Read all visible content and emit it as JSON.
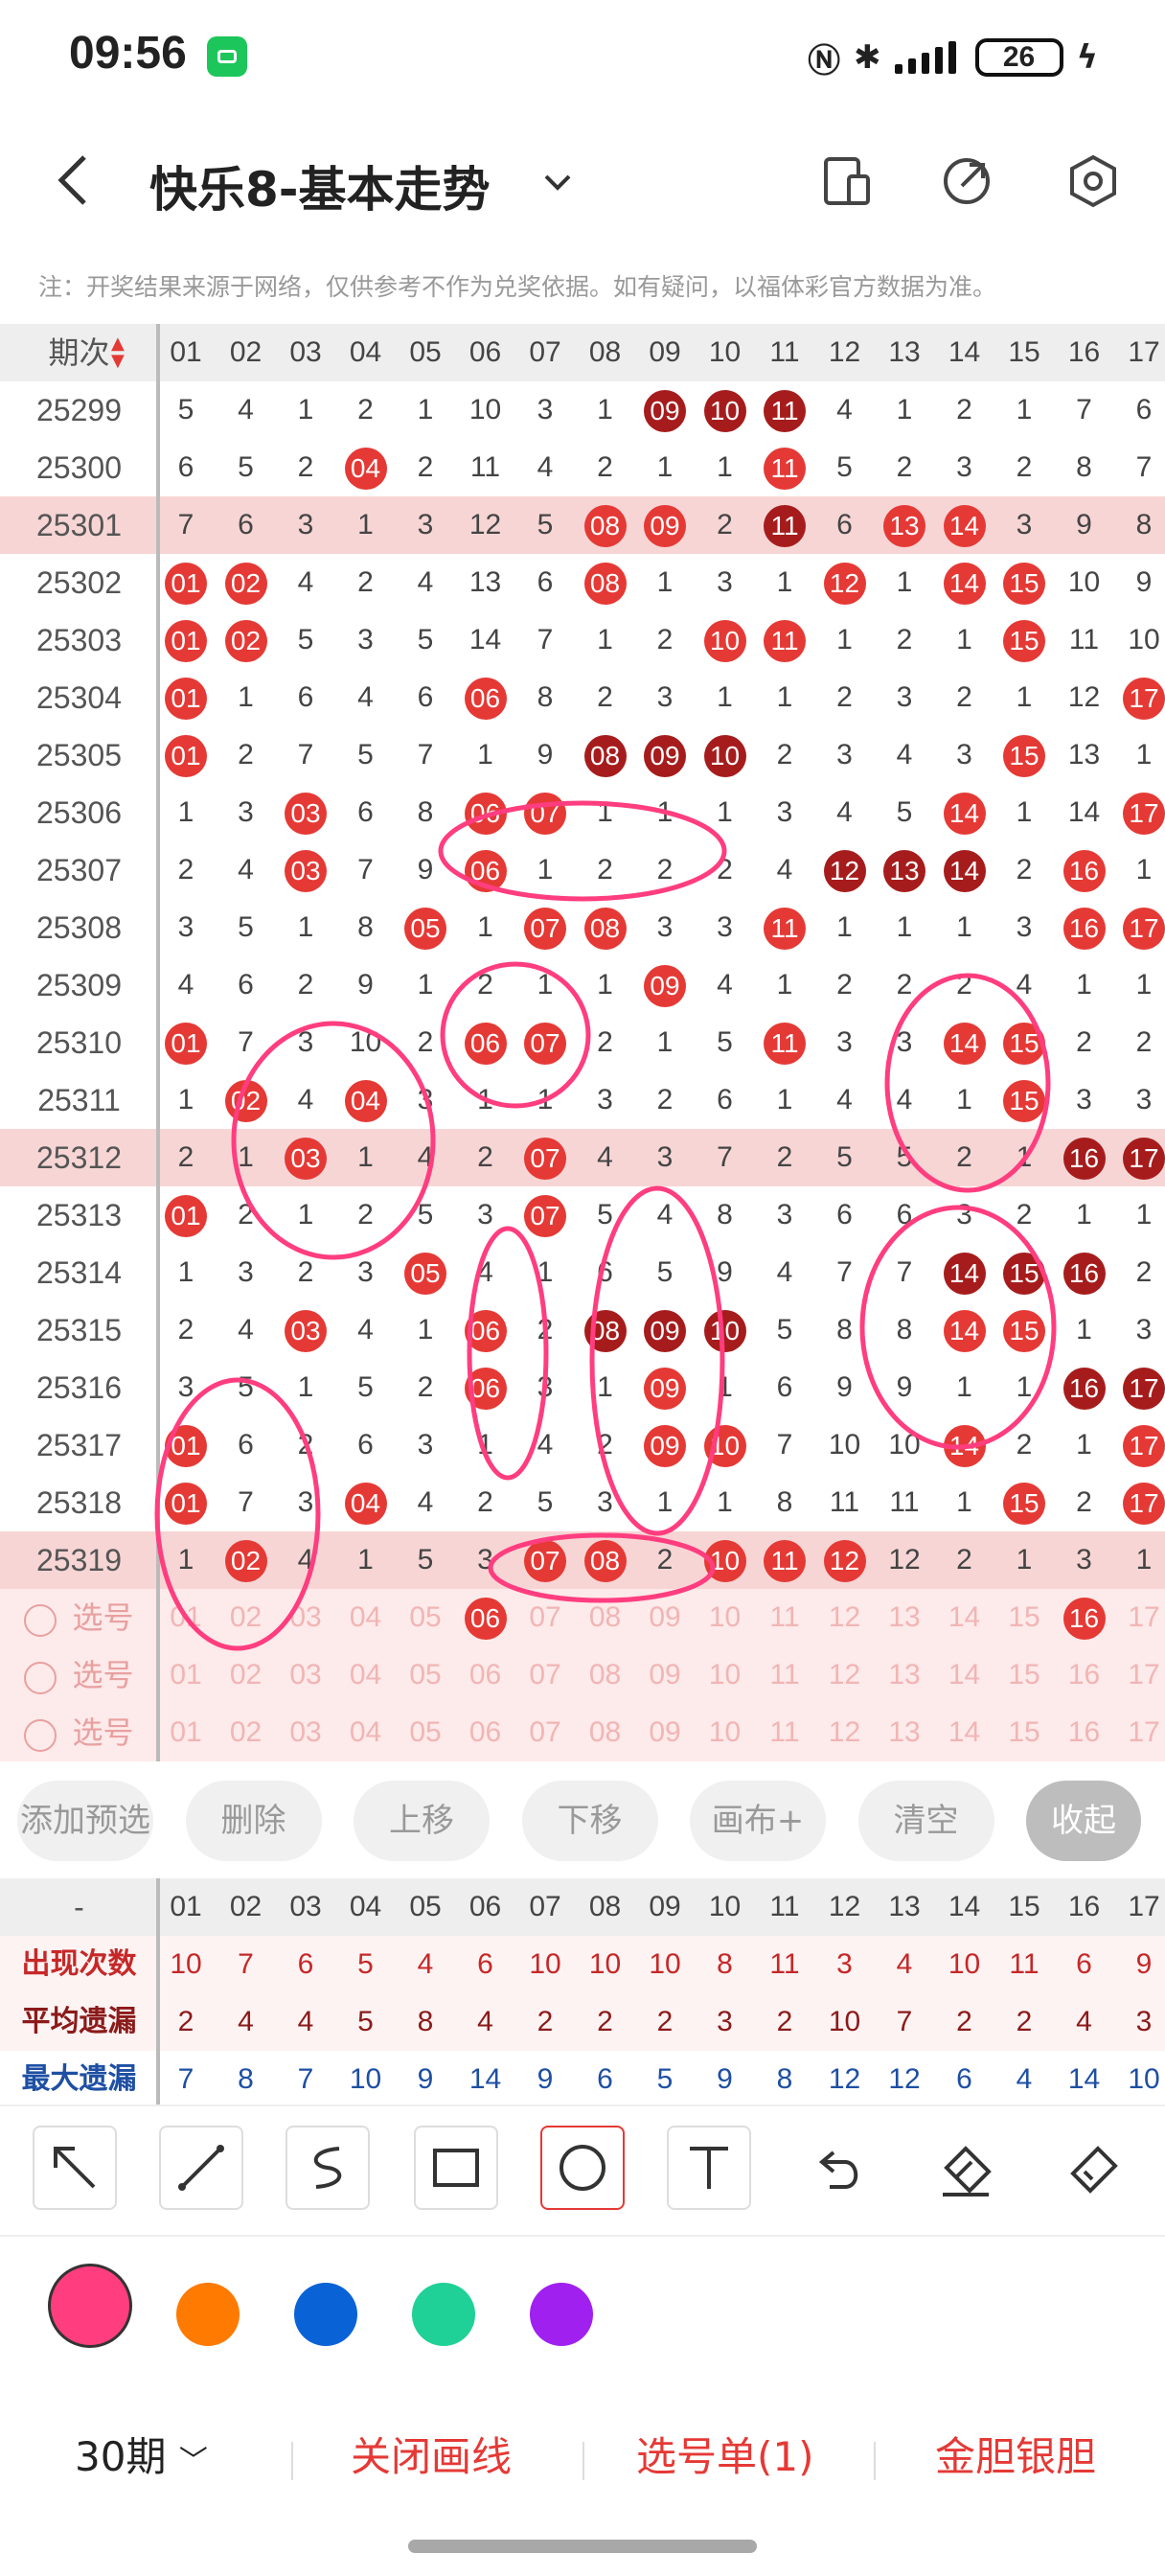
{
  "status": {
    "time": "09:56",
    "battery": "26"
  },
  "header": {
    "title": "快乐8-基本走势"
  },
  "notice": "注：开奖结果来源于网络，仅供参考不作为兑奖依据。如有疑问，以福体彩官方数据为准。",
  "table": {
    "period_header": "期次",
    "columns": [
      "01",
      "02",
      "03",
      "04",
      "05",
      "06",
      "07",
      "08",
      "09",
      "10",
      "11",
      "12",
      "13",
      "14",
      "15",
      "16",
      "17"
    ],
    "rows": [
      {
        "p": "25299",
        "v": [
          "5",
          "4",
          "1",
          "2",
          "1",
          "10",
          "3",
          "1",
          "09",
          "10",
          "11",
          "4",
          "1",
          "2",
          "1",
          "7",
          "6"
        ]
      },
      {
        "p": "25300",
        "v": [
          "6",
          "5",
          "2",
          "04",
          "2",
          "11",
          "4",
          "2",
          "1",
          "1",
          "11",
          "5",
          "2",
          "3",
          "2",
          "8",
          "7"
        ]
      },
      {
        "p": "25301",
        "v": [
          "7",
          "6",
          "3",
          "1",
          "3",
          "12",
          "5",
          "08",
          "09",
          "2",
          "11",
          "6",
          "13",
          "14",
          "3",
          "9",
          "8"
        ]
      },
      {
        "p": "25302",
        "v": [
          "01",
          "02",
          "4",
          "2",
          "4",
          "13",
          "6",
          "08",
          "1",
          "3",
          "1",
          "12",
          "1",
          "14",
          "15",
          "10",
          "9"
        ]
      },
      {
        "p": "25303",
        "v": [
          "01",
          "02",
          "5",
          "3",
          "5",
          "14",
          "7",
          "1",
          "2",
          "10",
          "11",
          "1",
          "2",
          "1",
          "15",
          "11",
          "10"
        ]
      },
      {
        "p": "25304",
        "v": [
          "01",
          "1",
          "6",
          "4",
          "6",
          "06",
          "8",
          "2",
          "3",
          "1",
          "1",
          "2",
          "3",
          "2",
          "1",
          "12",
          "17"
        ]
      },
      {
        "p": "25305",
        "v": [
          "01",
          "2",
          "7",
          "5",
          "7",
          "1",
          "9",
          "08",
          "09",
          "10",
          "2",
          "3",
          "4",
          "3",
          "15",
          "13",
          "1"
        ]
      },
      {
        "p": "25306",
        "v": [
          "1",
          "3",
          "03",
          "6",
          "8",
          "06",
          "07",
          "1",
          "1",
          "1",
          "3",
          "4",
          "5",
          "14",
          "1",
          "14",
          "17"
        ]
      },
      {
        "p": "25307",
        "v": [
          "2",
          "4",
          "03",
          "7",
          "9",
          "06",
          "1",
          "2",
          "2",
          "2",
          "4",
          "12",
          "13",
          "14",
          "2",
          "16",
          "1"
        ]
      },
      {
        "p": "25308",
        "v": [
          "3",
          "5",
          "1",
          "8",
          "05",
          "1",
          "07",
          "08",
          "3",
          "3",
          "11",
          "1",
          "1",
          "1",
          "3",
          "16",
          "17"
        ]
      },
      {
        "p": "25309",
        "v": [
          "4",
          "6",
          "2",
          "9",
          "1",
          "2",
          "1",
          "1",
          "09",
          "4",
          "1",
          "2",
          "2",
          "2",
          "4",
          "1",
          "1"
        ]
      },
      {
        "p": "25310",
        "v": [
          "01",
          "7",
          "3",
          "10",
          "2",
          "06",
          "07",
          "2",
          "1",
          "5",
          "11",
          "3",
          "3",
          "14",
          "15",
          "2",
          "2"
        ]
      },
      {
        "p": "25311",
        "v": [
          "1",
          "02",
          "4",
          "04",
          "3",
          "1",
          "1",
          "3",
          "2",
          "6",
          "1",
          "4",
          "4",
          "1",
          "15",
          "3",
          "3"
        ]
      },
      {
        "p": "25312",
        "v": [
          "2",
          "1",
          "03",
          "1",
          "4",
          "2",
          "07",
          "4",
          "3",
          "7",
          "2",
          "5",
          "5",
          "2",
          "1",
          "16",
          "17"
        ]
      },
      {
        "p": "25313",
        "v": [
          "01",
          "2",
          "1",
          "2",
          "5",
          "3",
          "07",
          "5",
          "4",
          "8",
          "3",
          "6",
          "6",
          "3",
          "2",
          "1",
          "1"
        ]
      },
      {
        "p": "25314",
        "v": [
          "1",
          "3",
          "2",
          "3",
          "05",
          "4",
          "1",
          "6",
          "5",
          "9",
          "4",
          "7",
          "7",
          "14",
          "15",
          "16",
          "2"
        ]
      },
      {
        "p": "25315",
        "v": [
          "2",
          "4",
          "03",
          "4",
          "1",
          "06",
          "2",
          "08",
          "09",
          "10",
          "5",
          "8",
          "8",
          "14",
          "15",
          "1",
          "3"
        ]
      },
      {
        "p": "25316",
        "v": [
          "3",
          "5",
          "1",
          "5",
          "2",
          "06",
          "3",
          "1",
          "09",
          "1",
          "6",
          "9",
          "9",
          "1",
          "1",
          "16",
          "17"
        ]
      },
      {
        "p": "25317",
        "v": [
          "01",
          "6",
          "2",
          "6",
          "3",
          "1",
          "4",
          "2",
          "09",
          "10",
          "7",
          "10",
          "10",
          "14",
          "2",
          "1",
          "17"
        ]
      },
      {
        "p": "25318",
        "v": [
          "01",
          "7",
          "3",
          "04",
          "4",
          "2",
          "5",
          "3",
          "1",
          "1",
          "8",
          "11",
          "11",
          "1",
          "15",
          "2",
          "17"
        ]
      },
      {
        "p": "25319",
        "v": [
          "1",
          "02",
          "4",
          "1",
          "5",
          "3",
          "07",
          "08",
          "2",
          "10",
          "11",
          "12",
          "12",
          "2",
          "1",
          "3",
          "1"
        ]
      }
    ],
    "pick_label": "选号",
    "pick_rows": [
      [
        "01",
        "02",
        "03",
        "04",
        "05",
        "06",
        "07",
        "08",
        "09",
        "10",
        "11",
        "12",
        "13",
        "14",
        "15",
        "16",
        "17"
      ],
      [
        "01",
        "02",
        "03",
        "04",
        "05",
        "06",
        "07",
        "08",
        "09",
        "10",
        "11",
        "12",
        "13",
        "14",
        "15",
        "16",
        "17"
      ],
      [
        "01",
        "02",
        "03",
        "04",
        "05",
        "06",
        "07",
        "08",
        "09",
        "10",
        "11",
        "12",
        "13",
        "14",
        "15",
        "16",
        "17"
      ]
    ]
  },
  "actions": [
    "添加预选",
    "删除",
    "上移",
    "下移",
    "画布+",
    "清空",
    "收起"
  ],
  "stats": {
    "header_label": "-",
    "rows": [
      {
        "label": "出现次数",
        "values": [
          "10",
          "7",
          "6",
          "5",
          "4",
          "6",
          "10",
          "10",
          "10",
          "8",
          "11",
          "3",
          "4",
          "10",
          "11",
          "6",
          "9"
        ]
      },
      {
        "label": "平均遗漏",
        "values": [
          "2",
          "4",
          "4",
          "5",
          "8",
          "4",
          "2",
          "2",
          "2",
          "3",
          "2",
          "10",
          "7",
          "2",
          "2",
          "4",
          "3"
        ]
      },
      {
        "label": "最大遗漏",
        "values": [
          "7",
          "8",
          "7",
          "10",
          "9",
          "14",
          "9",
          "6",
          "5",
          "9",
          "8",
          "12",
          "12",
          "6",
          "4",
          "14",
          "10"
        ]
      }
    ]
  },
  "tools": [
    "arrow-icon",
    "line-icon",
    "freehand-icon",
    "rectangle-icon",
    "circle-icon",
    "text-icon",
    "undo-icon",
    "eraser-icon",
    "clear-brush-icon"
  ],
  "colors": [
    "#ff3d7f",
    "#ff7a00",
    "#0a63d6",
    "#1fd196",
    "#a020f0"
  ],
  "bottom": {
    "period_select": "30期",
    "close_draw": "关闭画线",
    "pick_list": "选号单(1)",
    "gold_silver": "金胆银胆"
  }
}
